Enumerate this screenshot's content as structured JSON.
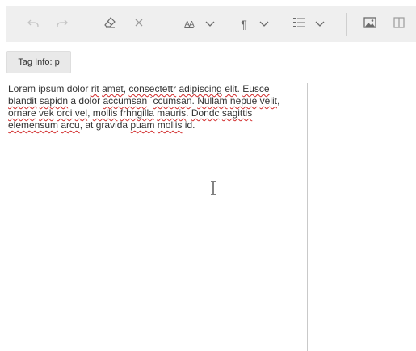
{
  "toolbar": {
    "buttons": [
      {
        "icon": "undo-icon"
      },
      {
        "icon": "redo-icon"
      },
      {
        "icon": "eraser-icon"
      },
      {
        "icon": "clear-icon"
      },
      {
        "icon": "font-size-icon",
        "glyph": "AA"
      },
      {
        "icon": "chevron-down-icon"
      },
      {
        "icon": "paragraph-icon",
        "glyph": "¶"
      },
      {
        "icon": "chevron-down-icon"
      },
      {
        "icon": "list-icon"
      },
      {
        "icon": "chevron-down-icon"
      },
      {
        "icon": "image-icon"
      },
      {
        "icon": "split-view-icon"
      }
    ]
  },
  "tag_info": {
    "label": "Tag Info: p"
  },
  "editor": {
    "segments": [
      {
        "text": "Lorem ipsum dolor ",
        "spell": false
      },
      {
        "text": "rit",
        "spell": true
      },
      {
        "text": " ",
        "spell": false
      },
      {
        "text": "amet",
        "spell": true
      },
      {
        "text": ", ",
        "spell": false
      },
      {
        "text": "consectettr",
        "spell": true
      },
      {
        "text": " ",
        "spell": false
      },
      {
        "text": "adipiscing",
        "spell": true
      },
      {
        "text": " ",
        "spell": false
      },
      {
        "text": "elit",
        "spell": true
      },
      {
        "text": ". ",
        "spell": false
      },
      {
        "text": "Eusce",
        "spell": true
      },
      {
        "text": " ",
        "spell": false
      },
      {
        "text": "blandit",
        "spell": true
      },
      {
        "text": " ",
        "spell": false
      },
      {
        "text": "sapidn",
        "spell": true
      },
      {
        "text": " a dolor ",
        "spell": false
      },
      {
        "text": "accumsan",
        "spell": true
      },
      {
        "text": " `",
        "spell": false
      },
      {
        "text": "ccumsan",
        "spell": true
      },
      {
        "text": ". ",
        "spell": false
      },
      {
        "text": "Nullam",
        "spell": true
      },
      {
        "text": " ",
        "spell": false
      },
      {
        "text": "nepue",
        "spell": true
      },
      {
        "text": " ",
        "spell": false
      },
      {
        "text": "velit",
        "spell": true
      },
      {
        "text": ", ",
        "spell": false
      },
      {
        "text": "ornare",
        "spell": true
      },
      {
        "text": " ",
        "spell": false
      },
      {
        "text": "vek",
        "spell": true
      },
      {
        "text": " ",
        "spell": false
      },
      {
        "text": "orci",
        "spell": true
      },
      {
        "text": " ",
        "spell": false
      },
      {
        "text": "vel",
        "spell": true
      },
      {
        "text": ", ",
        "spell": false
      },
      {
        "text": "mollis",
        "spell": true
      },
      {
        "text": " ",
        "spell": false
      },
      {
        "text": "frhngilla",
        "spell": true
      },
      {
        "text": " ",
        "spell": false
      },
      {
        "text": "mauris",
        "spell": true
      },
      {
        "text": ". ",
        "spell": false
      },
      {
        "text": "Dondc",
        "spell": true
      },
      {
        "text": " ",
        "spell": false
      },
      {
        "text": "sagittis",
        "spell": true
      },
      {
        "text": " ",
        "spell": false
      },
      {
        "text": "elemensum",
        "spell": true
      },
      {
        "text": " ",
        "spell": false
      },
      {
        "text": "arcu",
        "spell": true
      },
      {
        "text": ", at gravida ",
        "spell": false
      },
      {
        "text": "puam",
        "spell": true
      },
      {
        "text": " ",
        "spell": false
      },
      {
        "text": "mollis",
        "spell": true
      },
      {
        "text": " id.",
        "spell": false
      }
    ]
  },
  "colors": {
    "toolbar_bg": "#efefef",
    "icon": "#6b6b6b",
    "icon_disabled": "#c4c4c4",
    "spell_underline": "#d12b2b"
  }
}
